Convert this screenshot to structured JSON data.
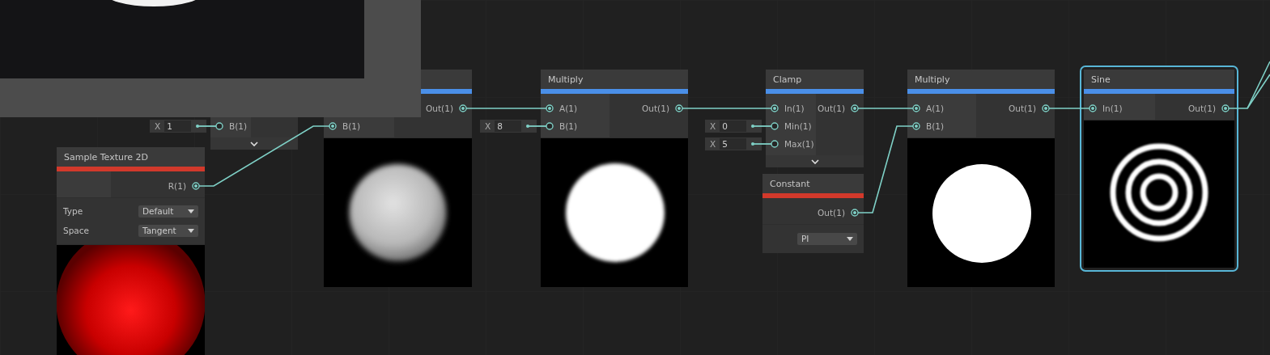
{
  "main_preview": {
    "kind": "picture"
  },
  "nodes": [
    {
      "selected": false,
      "inputs": [
        {
          "label": "B(1)",
          "axis": "X",
          "value": "1",
          "connected": false
        }
      ],
      "expandable": true
    },
    {
      "color": "#4a8fe8",
      "selected": false,
      "inputs": [
        {
          "label": "B(1)",
          "connected": true
        }
      ],
      "outputs": [
        {
          "label": "Out(1)",
          "connected": true
        }
      ],
      "preview": {
        "kind": "picture"
      }
    },
    {
      "title": "Sample Texture 2D",
      "color": "#d2392b",
      "selected": false,
      "outputs": [
        {
          "label": "R(1)",
          "connected": true
        }
      ],
      "settings": [
        {
          "label": "Type",
          "value": "Default"
        },
        {
          "label": "Space",
          "value": "Tangent"
        }
      ],
      "preview": {
        "kind": "picture"
      }
    },
    {
      "title": "Multiply",
      "color": "#4a8fe8",
      "selected": false,
      "inputs": [
        {
          "label": "A(1)",
          "connected": true
        },
        {
          "label": "B(1)",
          "axis": "X",
          "value": "8",
          "connected": false
        }
      ],
      "outputs": [
        {
          "label": "Out(1)",
          "connected": true
        }
      ],
      "preview": {
        "kind": "picture"
      }
    },
    {
      "title": "Clamp",
      "color": "#4a8fe8",
      "selected": false,
      "inputs": [
        {
          "label": "In(1)",
          "connected": true
        },
        {
          "label": "Min(1)",
          "axis": "X",
          "value": "0",
          "connected": false
        },
        {
          "label": "Max(1)",
          "axis": "X",
          "value": "5",
          "connected": false
        }
      ],
      "outputs": [
        {
          "label": "Out(1)",
          "connected": true
        }
      ],
      "expandable": true
    },
    {
      "title": "Constant",
      "color": "#d2392b",
      "selected": false,
      "outputs": [
        {
          "label": "Out(1)",
          "connected": true
        }
      ],
      "settings": [
        {
          "value": "PI"
        }
      ]
    },
    {
      "title": "Multiply",
      "color": "#4a8fe8",
      "selected": false,
      "inputs": [
        {
          "label": "A(1)",
          "connected": true
        },
        {
          "label": "B(1)",
          "connected": true
        }
      ],
      "outputs": [
        {
          "label": "Out(1)",
          "connected": true
        }
      ],
      "preview": {
        "kind": "picture"
      }
    },
    {
      "title": "Sine",
      "color": "#4a8fe8",
      "selected": true,
      "inputs": [
        {
          "label": "In(1)",
          "connected": true
        }
      ],
      "outputs": [
        {
          "label": "Out(1)",
          "connected": true
        }
      ],
      "preview": {
        "kind": "picture"
      }
    }
  ]
}
